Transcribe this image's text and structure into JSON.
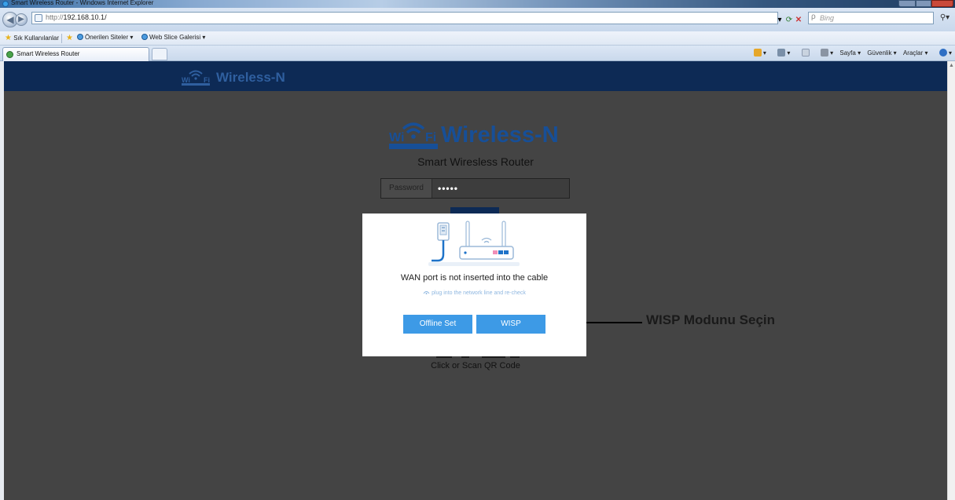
{
  "window": {
    "title": "Smart Wireless Router - Windows Internet Explorer"
  },
  "address_bar": {
    "protocol": "http://",
    "host": "192.168.10.1/",
    "search_placeholder": "Bing"
  },
  "favorites_bar": {
    "favorites_label": "Sık Kullanılanlar",
    "suggested_sites": "Önerilen Siteler ▾",
    "web_slice_gallery": "Web Slice Galerisi ▾"
  },
  "tab": {
    "label": "Smart Wireless Router"
  },
  "command_bar": {
    "page": "Sayfa ▾",
    "safety": "Güvenlik ▾",
    "tools": "Araçlar ▾"
  },
  "header": {
    "brand": "Wireless-N"
  },
  "login": {
    "brand": "Wireless-N",
    "subtitle": "Smart Wiresless Router",
    "password_label": "Password",
    "password_value": "•••••",
    "qr_text": "Click or Scan QR Code"
  },
  "modal": {
    "message": "WAN port is not inserted into the cable",
    "hint": "plug into the network line and re-check",
    "offline_button": "Offline Set",
    "wisp_button": "WISP"
  },
  "annotation": {
    "text": "WISP Modunu Seçin"
  },
  "colors": {
    "header_bg": "#0d2a55",
    "page_bg": "#444444",
    "brand_blue": "#174f97",
    "button_blue": "#3d9ae6"
  }
}
